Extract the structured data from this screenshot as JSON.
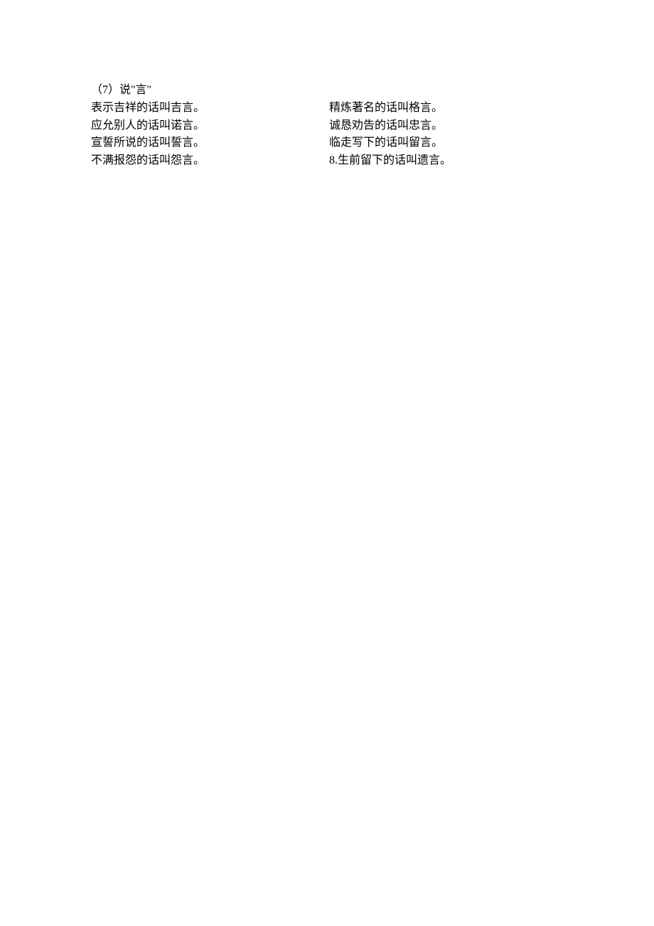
{
  "heading": "（7）说\"言\"",
  "left": [
    "表示吉祥的话叫吉言。",
    "应允别人的话叫诺言。",
    "宣誓所说的话叫誓言。",
    "不满报怨的话叫怨言。"
  ],
  "right": [
    "精炼著名的话叫格言。",
    "诚恳劝告的话叫忠言。",
    "临走写下的话叫留言。",
    "8.生前留下的话叫遗言。"
  ]
}
